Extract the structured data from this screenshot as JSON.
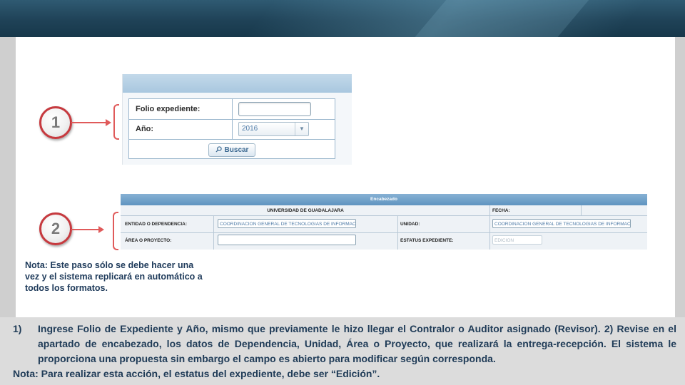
{
  "step1": {
    "number": "1",
    "folio_label": "Folio expediente:",
    "folio_value": "",
    "anio_label": "Año:",
    "anio_value": "2016",
    "buscar_label": "Buscar"
  },
  "step2": {
    "number": "2",
    "panel_title": "Encabezado",
    "universidad": "UNIVERSIDAD DE GUADALAJARA",
    "fecha_label": "FECHA:",
    "entidad_label": "ENTIDAD O DEPENDENCIA:",
    "entidad_value": "COORDINACION GENERAL DE TECNOLOGIAS DE INFORMACION",
    "unidad_label": "UNIDAD:",
    "unidad_value": "COORDINACION GENERAL DE TECNOLOGIAS DE INFORMACION",
    "area_label": "ÁREA O PROYECTO:",
    "area_value": "",
    "estatus_label": "ESTATUS EXPEDIENTE:",
    "estatus_value": "EDICION"
  },
  "note": "Nota: Este paso sólo se debe hacer una vez y el sistema replicará en automático a todos los formatos.",
  "instructions": {
    "number": "1)",
    "text": "Ingrese Folio de Expediente y Año, mismo que previamente le hizo llegar el Contralor o Auditor asignado (Revisor). 2) Revise en el apartado de encabezado, los datos de Dependencia, Unidad, Área o Proyecto, que realizará la entrega-recepción. El sistema le proporciona una propuesta sin embargo el campo es abierto para modificar según corresponda.",
    "note": "Nota: Para realizar esta acción, el estatus del expediente, debe ser “Edición”."
  },
  "colors": {
    "accent_red": "#c63a3f",
    "text_blue": "#1f3b57",
    "header_blue": "#5f94c0"
  }
}
